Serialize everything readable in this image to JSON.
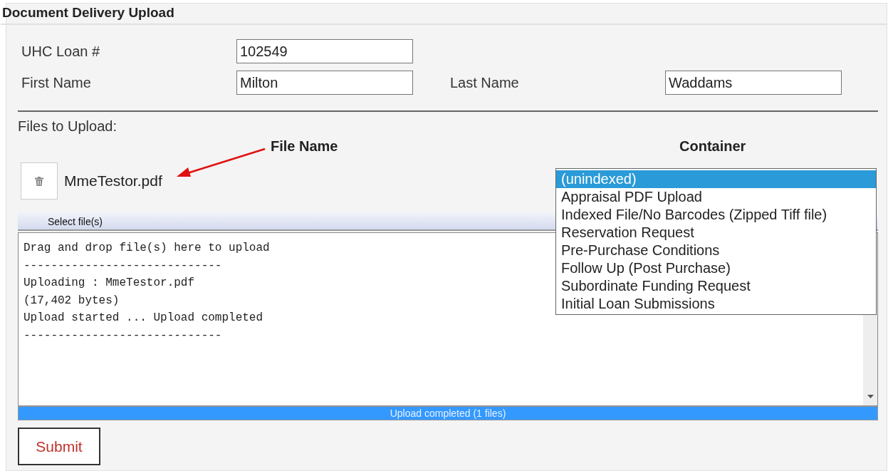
{
  "panel": {
    "title": "Document Delivery Upload"
  },
  "fields": [
    {
      "label": "UHC Loan #",
      "value": "102549"
    },
    {
      "label": "First Name",
      "value": "Milton"
    },
    {
      "label": "Last Name",
      "value": "Waddams"
    }
  ],
  "files": {
    "label": "Files to Upload:",
    "columns": [
      "File Name",
      "Container"
    ],
    "rows": [
      {
        "file_name": "MmeTestor.pdf",
        "annotated": true
      }
    ]
  },
  "container_options": [
    {
      "label": "(unindexed)",
      "selected": true
    },
    {
      "label": "Appraisal PDF Upload",
      "selected": false
    },
    {
      "label": "Indexed File/No Barcodes (Zipped Tiff file)",
      "selected": false
    },
    {
      "label": "Reservation Request",
      "selected": false
    },
    {
      "label": "Pre-Purchase Conditions",
      "selected": false
    },
    {
      "label": "Follow Up (Post Purchase)",
      "selected": false
    },
    {
      "label": "Subordinate Funding Request",
      "selected": false
    },
    {
      "label": "Initial Loan Submissions",
      "selected": false
    }
  ],
  "uploader": {
    "select_label": "Select file(s)",
    "log": [
      "Drag and drop file(s) here to upload",
      "-----------------------------",
      "Uploading : MmeTestor.pdf",
      "(17,402 bytes)",
      "Upload started ... Upload completed",
      "-----------------------------"
    ],
    "progress": {
      "level": 1,
      "text": "Upload completed (1 files)"
    }
  },
  "buttons": [
    {
      "label": "Submit"
    }
  ]
}
